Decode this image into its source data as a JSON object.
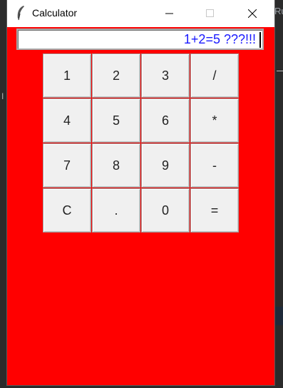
{
  "window": {
    "title": "Calculator"
  },
  "display": {
    "value": "1+2=5 ???!!!"
  },
  "keys": [
    [
      "1",
      "2",
      "3",
      "/"
    ],
    [
      "4",
      "5",
      "6",
      "*"
    ],
    [
      "7",
      "8",
      "9",
      "-"
    ],
    [
      "C",
      ".",
      "0",
      "="
    ]
  ],
  "background": {
    "right_text": "Ru",
    "left_text": "I",
    "right_dash": "—"
  },
  "colors": {
    "window_bg": "#ff0000",
    "display_text": "#1a1aff",
    "key_bg": "#f0f0f0"
  }
}
